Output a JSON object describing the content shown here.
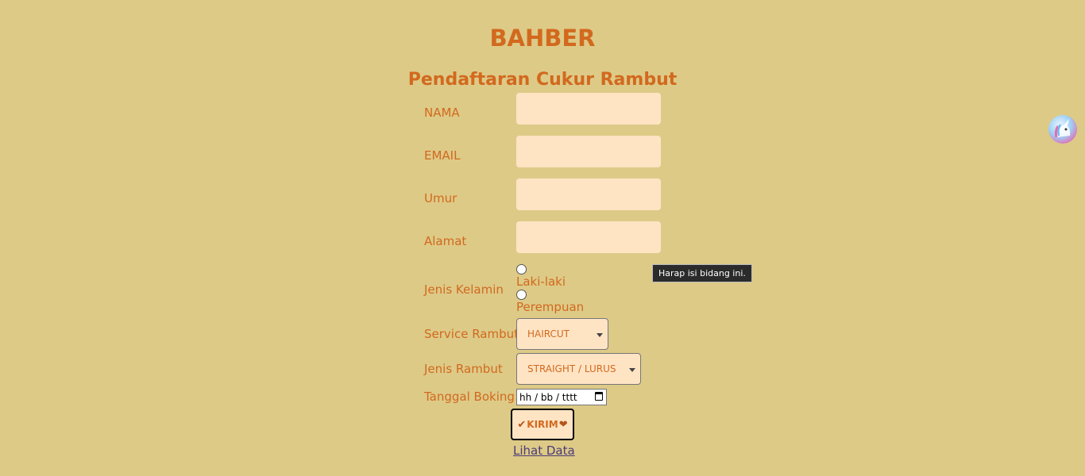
{
  "header": {
    "brand": "BAHBER",
    "title": "Pendaftaran Cukur Rambut"
  },
  "form": {
    "nama_label": "NAMA",
    "email_label": "EMAIL",
    "umur_label": "Umur",
    "alamat_label": "Alamat",
    "gender_label": "Jenis Kelamin",
    "gender_options": [
      "Laki-laki",
      "Perempuan"
    ],
    "service_label": "Service Rambut",
    "service_selected": "HAIRCUT",
    "hair_type_label": "Jenis Rambut",
    "hair_type_selected": "STRAIGHT / LURUS",
    "date_label": "Tanggal Boking",
    "date_placeholder": "hh / bb / tttt",
    "submit_label": "KIRIM",
    "view_link": "Lihat Data"
  },
  "tooltip": {
    "text": "Harap isi bidang ini."
  },
  "icons": {
    "submit_leading": "check-icon",
    "submit_trailing": "heart-icon",
    "extension": "unicorn-avatar-icon"
  },
  "colors": {
    "background": "#ddca87",
    "accent": "#d2691e",
    "input_fill": "#ffe4c4",
    "link": "#4b3a78"
  }
}
